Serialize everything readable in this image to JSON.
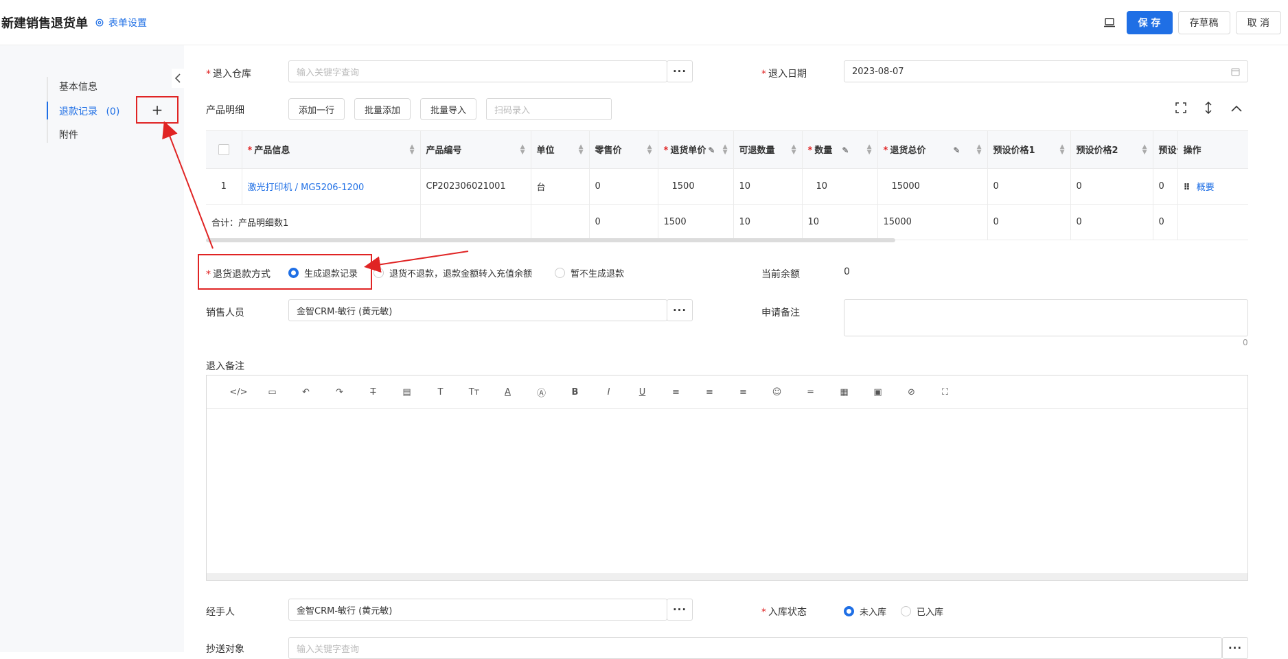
{
  "header": {
    "title": "新建销售退货单",
    "form_settings": "表单设置",
    "save": "保 存",
    "draft": "存草稿",
    "cancel": "取 消"
  },
  "sidebar": {
    "items": [
      {
        "label": "基本信息"
      },
      {
        "label": "退款记录",
        "count": "(0)"
      },
      {
        "label": "附件"
      }
    ],
    "add": "+"
  },
  "form": {
    "warehouse_label": "退入仓库",
    "warehouse_placeholder": "输入关键字查询",
    "date_label": "退入日期",
    "date_value": "2023-08-07",
    "detail_label": "产品明细",
    "add_row": "添加一行",
    "batch_add": "批量添加",
    "batch_import": "批量导入",
    "scan_placeholder": "扫码录入",
    "refund_method_label": "退货退款方式",
    "refund_options": [
      "生成退款记录",
      "退货不退款，退款金额转入充值余额",
      "暂不生成退款"
    ],
    "balance_label": "当前余额",
    "balance_value": "0",
    "sales_label": "销售人员",
    "sales_value": "金智CRM-敏行 (黄元敏)",
    "apply_note_label": "申请备注",
    "apply_note_count": "0",
    "return_note_label": "退入备注",
    "handler_label": "经手人",
    "handler_value": "金智CRM-敏行 (黄元敏)",
    "stock_status_label": "入库状态",
    "stock_options": [
      "未入库",
      "已入库"
    ],
    "cc_label": "抄送对象",
    "cc_placeholder": "输入关键字查询",
    "dots": "···"
  },
  "table": {
    "headers": [
      "产品信息",
      "产品编号",
      "单位",
      "零售价",
      "退货单价",
      "可退数量",
      "数量",
      "退货总价",
      "预设价格1",
      "预设价格2",
      "预设价",
      "操作"
    ],
    "row": {
      "index": "1",
      "product": "激光打印机 / MG5206-1200",
      "code": "CP202306021001",
      "unit": "台",
      "retail": "0",
      "unit_price": "1500",
      "refundable": "10",
      "qty": "10",
      "total": "15000",
      "p1": "0",
      "p2": "0",
      "p3": "0",
      "action": "概要"
    },
    "summary": {
      "label": "合计：产品明细数1",
      "retail": "0",
      "unit_price": "1500",
      "refundable": "10",
      "qty": "10",
      "total": "15000",
      "p1": "0",
      "p2": "0",
      "p3": "0"
    }
  },
  "colors": {
    "accent": "#1f6fe5",
    "annotation": "#e02424"
  }
}
